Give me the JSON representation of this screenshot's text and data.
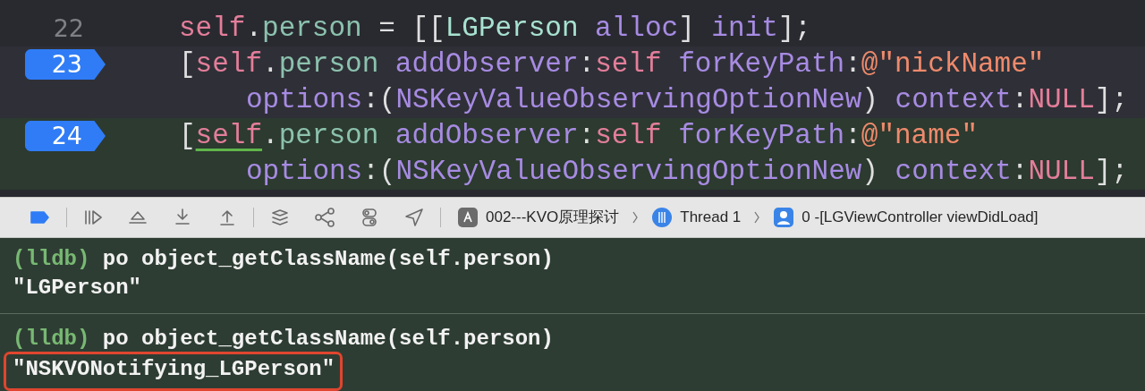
{
  "editor": {
    "lines": [
      {
        "kind": "statement",
        "number": "22",
        "breakpoint": false,
        "focused": false,
        "current": false,
        "tokens": [
          {
            "text": "self",
            "kind": "keyword"
          },
          {
            "text": ".",
            "kind": "plain"
          },
          {
            "text": "person",
            "kind": "property"
          },
          {
            "text": " = [[",
            "kind": "plain"
          },
          {
            "text": "LGPerson",
            "kind": "class"
          },
          {
            "text": " alloc",
            "kind": "method"
          },
          {
            "text": "] ",
            "kind": "plain"
          },
          {
            "text": "init",
            "kind": "method"
          },
          {
            "text": "];",
            "kind": "plain"
          }
        ]
      },
      {
        "kind": "statement",
        "number": "23",
        "breakpoint": true,
        "focused": true,
        "current": false,
        "tokens": [
          {
            "text": "[",
            "kind": "plain"
          },
          {
            "text": "self",
            "kind": "keyword"
          },
          {
            "text": ".",
            "kind": "plain"
          },
          {
            "text": "person",
            "kind": "property"
          },
          {
            "text": " addObserver",
            "kind": "method"
          },
          {
            "text": ":",
            "kind": "plain"
          },
          {
            "text": "self",
            "kind": "keyword"
          },
          {
            "text": " forKeyPath",
            "kind": "method"
          },
          {
            "text": ":",
            "kind": "plain"
          },
          {
            "text": "@\"nickName\"",
            "kind": "string"
          }
        ]
      },
      {
        "kind": "continuation",
        "tokens": [
          {
            "text": "options",
            "kind": "method"
          },
          {
            "text": ":(",
            "kind": "plain"
          },
          {
            "text": "NSKeyValueObservingOptionNew",
            "kind": "method"
          },
          {
            "text": ") ",
            "kind": "plain"
          },
          {
            "text": "context",
            "kind": "method"
          },
          {
            "text": ":",
            "kind": "plain"
          },
          {
            "text": "NULL",
            "kind": "keyword"
          },
          {
            "text": "];",
            "kind": "plain"
          }
        ]
      },
      {
        "kind": "statement",
        "number": "24",
        "breakpoint": true,
        "focused": false,
        "current": true,
        "tokens": [
          {
            "text": "[",
            "kind": "plain"
          },
          {
            "text": "self",
            "kind": "keyword",
            "underlined": true
          },
          {
            "text": ".",
            "kind": "plain"
          },
          {
            "text": "person",
            "kind": "property"
          },
          {
            "text": " addObserver",
            "kind": "method"
          },
          {
            "text": ":",
            "kind": "plain"
          },
          {
            "text": "self",
            "kind": "keyword"
          },
          {
            "text": " forKeyPath",
            "kind": "method"
          },
          {
            "text": ":",
            "kind": "plain"
          },
          {
            "text": "@\"name\"",
            "kind": "string"
          }
        ]
      },
      {
        "kind": "continuation",
        "tokens": [
          {
            "text": "options",
            "kind": "method"
          },
          {
            "text": ":(",
            "kind": "plain"
          },
          {
            "text": "NSKeyValueObservingOptionNew",
            "kind": "method"
          },
          {
            "text": ") ",
            "kind": "plain"
          },
          {
            "text": "context",
            "kind": "method"
          },
          {
            "text": ":",
            "kind": "plain"
          },
          {
            "text": "NULL",
            "kind": "keyword"
          },
          {
            "text": "];",
            "kind": "plain"
          }
        ]
      }
    ]
  },
  "debug_bar": {
    "breakpoints_active": true,
    "breadcrumbs": [
      {
        "kind": "app",
        "label": "002---KVO原理探讨"
      },
      {
        "kind": "thread",
        "label": "Thread 1"
      },
      {
        "kind": "frame",
        "label": "0 -[LGViewController viewDidLoad]"
      }
    ]
  },
  "console": {
    "entries": [
      {
        "prompt": "(lldb)",
        "command": "po object_getClassName(self.person)",
        "output": "\"LGPerson\"",
        "highlighted": false
      },
      {
        "prompt": "(lldb)",
        "command": "po object_getClassName(self.person)",
        "output": "\"NSKVONotifying_LGPerson\"",
        "highlighted": true
      }
    ]
  }
}
